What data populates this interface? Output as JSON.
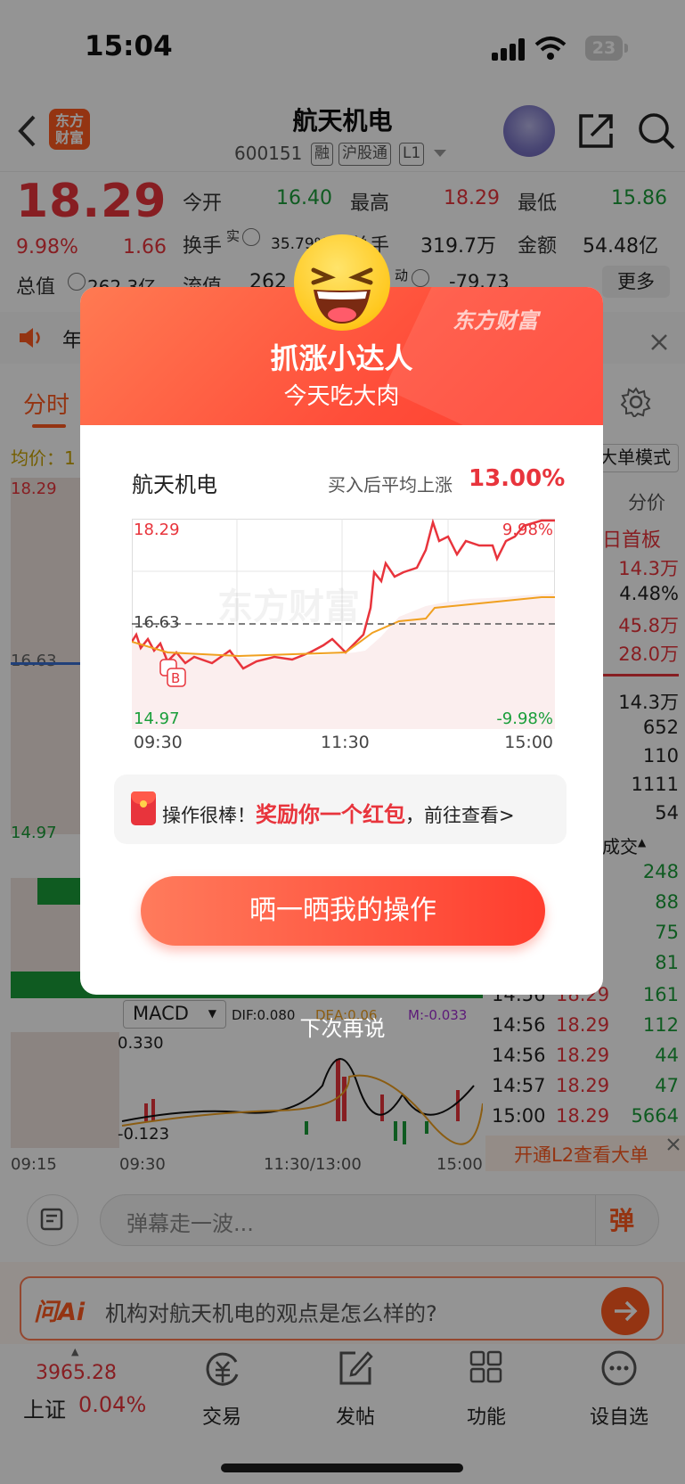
{
  "status": {
    "time": "15:04",
    "battery": "23"
  },
  "header": {
    "logo": "东方财富",
    "title": "航天机电",
    "code": "600151",
    "tags": [
      "融",
      "沪股通",
      "L1"
    ]
  },
  "quote": {
    "price": "18.29",
    "change_pct": "9.98%",
    "change": "1.66",
    "open_label": "今开",
    "open": "16.40",
    "high_label": "最高",
    "high": "18.29",
    "low_label": "最低",
    "low": "15.86",
    "turnover_label": "换手",
    "turnover_sup": "实",
    "turnover": "35.79%",
    "volume_label": "总手",
    "volume": "319.7万",
    "amount_label": "金额",
    "amount": "54.48亿",
    "mcap_label": "总值",
    "mcap": "262.3亿",
    "float_label": "流值",
    "float": "262",
    "dyn_sup": "动",
    "dyn": "-79.73",
    "more": "更多"
  },
  "notice": {
    "text": "年"
  },
  "tabs": {
    "timeshare": "分时"
  },
  "avg": {
    "label": "均价：1"
  },
  "left_chart": {
    "high": "18.29",
    "mid": "16.63",
    "low": "14.97"
  },
  "right_panel": {
    "mode": "大单模式",
    "col": "分价",
    "board": "日首板",
    "vals_top": [
      "14.3万",
      "4.48%",
      "45.8万",
      "28.0万"
    ],
    "vals_mid": [
      "14.3万",
      "652",
      "110",
      "1111",
      "54"
    ],
    "trade_label": "成交",
    "vol_a": [
      "248",
      "88",
      "75",
      "81"
    ],
    "trades": [
      {
        "time": "14:56",
        "price": "18.29",
        "vol": "161"
      },
      {
        "time": "14:56",
        "price": "18.29",
        "vol": "112"
      },
      {
        "time": "14:56",
        "price": "18.29",
        "vol": "44"
      },
      {
        "time": "14:57",
        "price": "18.29",
        "vol": "47"
      },
      {
        "time": "15:00",
        "price": "18.29",
        "vol": "5664"
      }
    ],
    "l2": "开通L2查看大单"
  },
  "macd": {
    "label": "MACD",
    "dif": "DIF:0.080",
    "dea": "DEA:0.06",
    "m": "M:-0.033",
    "top": "0.330",
    "bottom": "-0.123"
  },
  "x_axis": {
    "t0": "09:15",
    "t1": "09:30",
    "t2": "11:30/13:00",
    "t3": "15:00"
  },
  "modal": {
    "brand": "东方财富",
    "title": "抓涨小达人",
    "subtitle": "今天吃大肉",
    "stock": "航天机电",
    "rise_label": "买入后平均上涨",
    "rise": "13.00%",
    "ch_high": "18.29",
    "ch_mid": "16.63",
    "ch_low": "14.97",
    "ch_hp": "9.98%",
    "ch_lp": "-9.98%",
    "ch_t0": "09:30",
    "ch_t1": "11:30",
    "ch_t2": "15:00",
    "watermark": "东方财富",
    "reward_a": "操作很棒！",
    "reward_b": "奖励你一个红包",
    "reward_c": "，前往查看>",
    "share": "晒一晒我的操作",
    "later": "下次再说"
  },
  "danmu": {
    "placeholder": "弹幕走一波...",
    "btn": "弹"
  },
  "ai": {
    "logo": "问Ai",
    "question": "机构对航天机电的观点是怎么样的?"
  },
  "tabbar": {
    "index_value": "3965.28",
    "index_name": "上证",
    "index_pct": "0.04%",
    "trade": "交易",
    "post": "发帖",
    "func": "功能",
    "watch": "设自选"
  },
  "colors": {
    "up": "#e8343c",
    "down": "#1a9e3a",
    "accent": "#ff5a1f",
    "avg_line": "#f0a020"
  }
}
